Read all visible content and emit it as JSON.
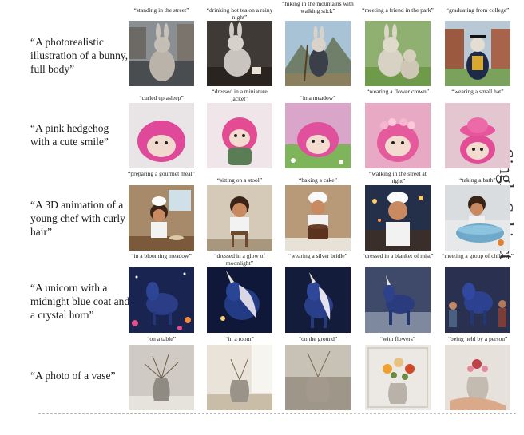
{
  "side_label": "Single Subject",
  "rows": [
    {
      "prompt": "“A photorealistic illustration of a bunny, full body”",
      "captions": [
        "“standing in the street”",
        "“drinking hot tea on a rainy night”",
        "“hiking in the mountains with walking stick”",
        "“meeting a friend in the park”",
        "“graduating from college”"
      ]
    },
    {
      "prompt": "“A pink hedgehog with a cute smile”",
      "captions": [
        "“curled up asleep”",
        "“dressed in a miniature jacket”",
        "“in a meadow”",
        "“wearing a flower crown”",
        "“wearing a small hat”"
      ]
    },
    {
      "prompt": "“A 3D animation of a young chef with curly hair”",
      "captions": [
        "“preparing a gourmet meal”",
        "“sitting on a stool”",
        "“baking a cake”",
        "“walking in the street at night”",
        "“taking a bath”"
      ]
    },
    {
      "prompt": "“A unicorn with a midnight blue coat and a crystal horn”",
      "captions": [
        "“in a blooming meadow”",
        "“dressed in a glow of moonlight”",
        "“wearing a silver bridle”",
        "“dressed in a blanket of mist”",
        "“meeting a group of children”"
      ]
    },
    {
      "prompt": "“A photo of a vase”",
      "captions": [
        "“on a table”",
        "“in a room”",
        "“on the ground”",
        "“with flowers”",
        "“being held by a person”"
      ]
    }
  ]
}
